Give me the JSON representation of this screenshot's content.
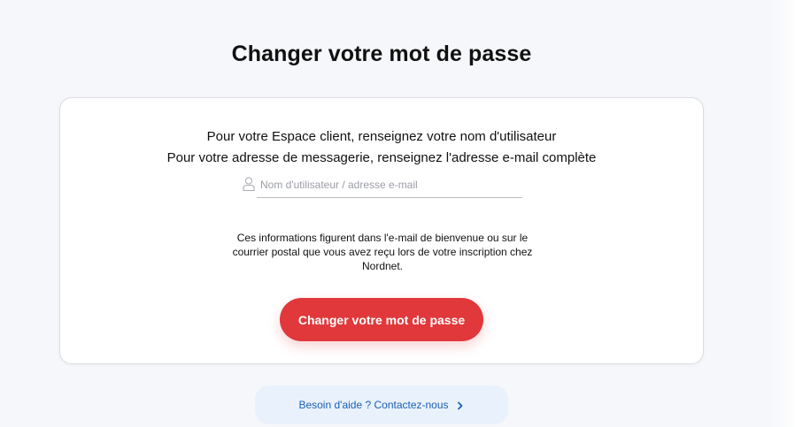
{
  "page": {
    "title": "Changer votre mot de passe"
  },
  "card": {
    "instruction_line1": "Pour votre Espace client, renseignez votre nom d'utilisateur",
    "instruction_line2": "Pour votre adresse de messagerie, renseignez l'adresse e-mail complète",
    "username_field": {
      "value": "",
      "placeholder": "Nom d'utilisateur / adresse e-mail",
      "icon": "user-icon"
    },
    "info_text": "Ces informations figurent dans l'e-mail de bienvenue ou sur le courrier postal que vous avez reçu lors de votre inscription chez Nordnet.",
    "submit_label": "Changer votre mot de passe"
  },
  "help": {
    "label": "Besoin d'aide ? Contactez-nous",
    "icon": "chevron-right-icon"
  },
  "colors": {
    "background": "#f6f7fa",
    "accent_red": "#e0383b",
    "link_blue": "#1a5fb4",
    "help_bg": "#e9f1fc"
  }
}
